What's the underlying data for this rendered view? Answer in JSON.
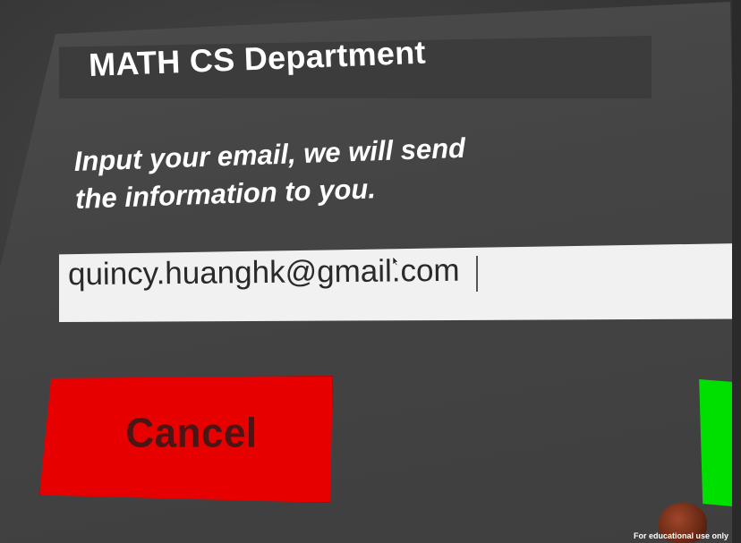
{
  "header": {
    "title": "MATH CS Department"
  },
  "form": {
    "instruction_line1": "Input your email, we will send",
    "instruction_line2": "the information to you.",
    "email_value": "quincy.huanghk@gmail.com"
  },
  "buttons": {
    "cancel_label": "Cancel",
    "cancel_color": "#e60000",
    "confirm_color": "#00e000"
  },
  "footer": {
    "watermark": "For educational use only"
  }
}
